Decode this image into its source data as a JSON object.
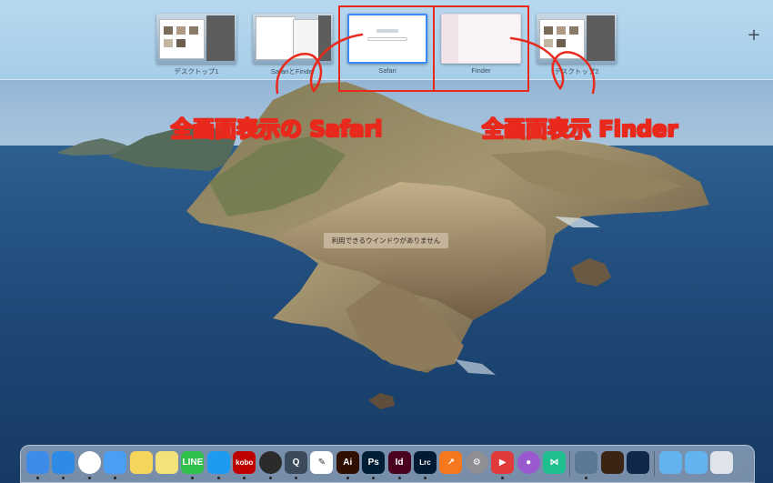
{
  "spaces": [
    {
      "id": "d1",
      "label": "デスクトップ1"
    },
    {
      "id": "sf",
      "label": "SafariとFinder"
    },
    {
      "id": "safari",
      "label": "Safari"
    },
    {
      "id": "finder",
      "label": "Finder"
    },
    {
      "id": "d2",
      "label": "デスクトップ2"
    }
  ],
  "add_space_symbol": "+",
  "annotations": {
    "safari": "全画面表示の Safari",
    "finder": "全画面表示 Finder",
    "color": "#e8291c"
  },
  "center_message": "利用できるウインドウがありません",
  "dock": {
    "items": [
      {
        "name": "finder-icon",
        "text": "",
        "color": "#3c8ce8"
      },
      {
        "name": "safari-icon",
        "text": "",
        "color": "#2d8be6"
      },
      {
        "name": "chrome-icon",
        "text": "",
        "color": "#ffffff"
      },
      {
        "name": "mail-icon",
        "text": "",
        "color": "#4a9ff5"
      },
      {
        "name": "notes-icon",
        "text": "",
        "color": "#f6d55c"
      },
      {
        "name": "stickies-icon",
        "text": "",
        "color": "#f3e27a"
      },
      {
        "name": "line-icon",
        "text": "LINE",
        "color": "#2fc14a"
      },
      {
        "name": "twitter-icon",
        "text": "",
        "color": "#1d9bf0"
      },
      {
        "name": "kobo-icon",
        "text": "kobo",
        "color": "#bf0000"
      },
      {
        "name": "obs-icon",
        "text": "",
        "color": "#2b2b2b"
      },
      {
        "name": "quicktime-icon",
        "text": "Q",
        "color": "#3a4a5a"
      },
      {
        "name": "pen-icon",
        "text": "✎",
        "color": "#ffffff"
      },
      {
        "name": "illustrator-icon",
        "text": "Ai",
        "color": "#2e0f00"
      },
      {
        "name": "photoshop-icon",
        "text": "Ps",
        "color": "#001e36"
      },
      {
        "name": "indesign-icon",
        "text": "Id",
        "color": "#49021f"
      },
      {
        "name": "lightroom-icon",
        "text": "Lrc",
        "color": "#001a33"
      },
      {
        "name": "chart-app-icon",
        "text": "↗",
        "color": "#f5781f"
      },
      {
        "name": "settings-icon",
        "text": "⚙",
        "color": "#8e8e93"
      },
      {
        "name": "player-icon",
        "text": "▶",
        "color": "#e03a3a"
      },
      {
        "name": "podcast-icon",
        "text": "●",
        "color": "#9b59d0"
      },
      {
        "name": "xcode-like-icon",
        "text": "⋈",
        "color": "#1fbf8f"
      },
      {
        "name": "preview-icon",
        "text": "",
        "color": "#5a7894"
      },
      {
        "name": "garageband-icon",
        "text": "",
        "color": "#3b2414"
      },
      {
        "name": "books-icon",
        "text": "",
        "color": "#10274a"
      },
      {
        "name": "folder-icon",
        "text": "",
        "color": "#63b3ee"
      },
      {
        "name": "folder2-icon",
        "text": "",
        "color": "#63b3ee"
      },
      {
        "name": "trash-icon",
        "text": "",
        "color": "#dfe4ea"
      }
    ]
  }
}
